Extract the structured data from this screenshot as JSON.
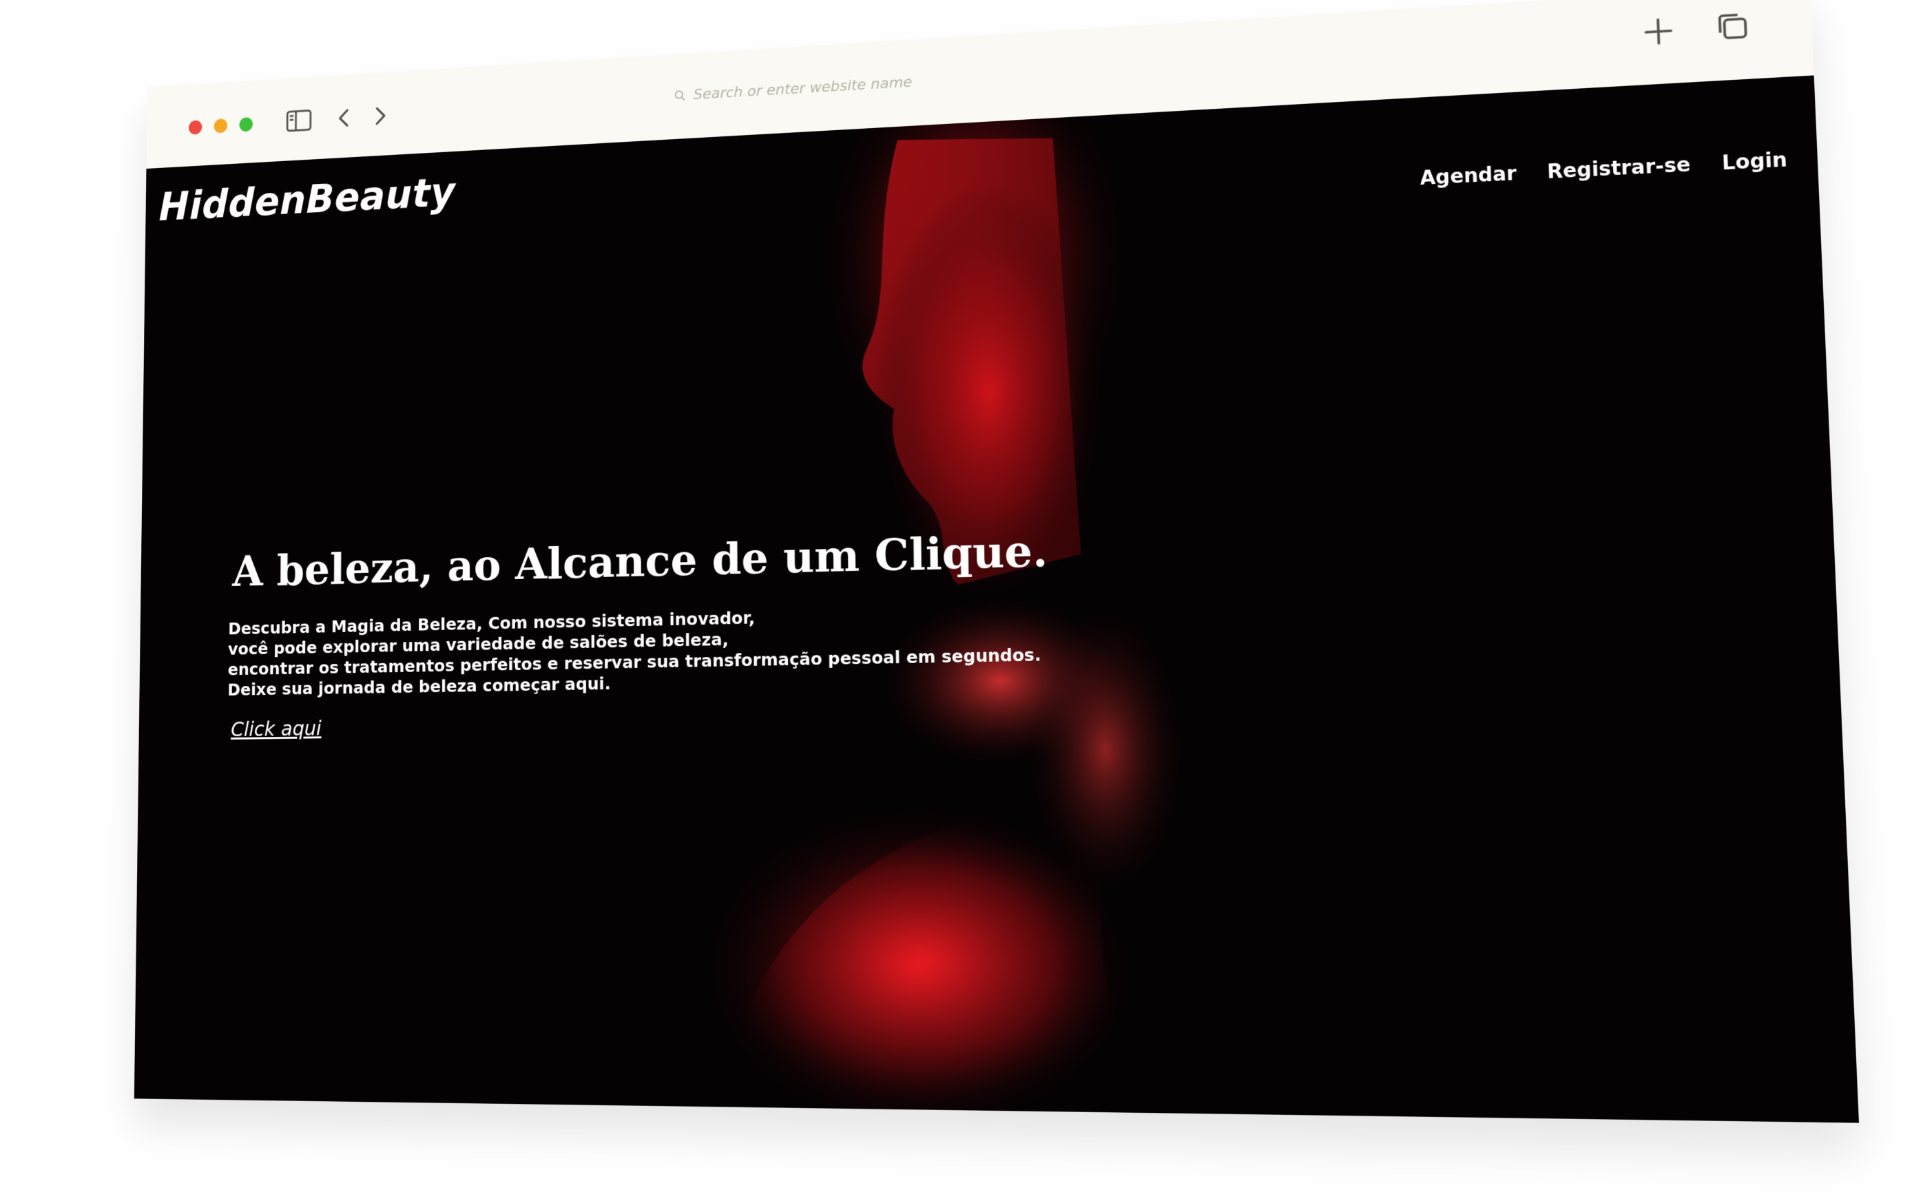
{
  "browser": {
    "address_placeholder": "Search or enter website name"
  },
  "site": {
    "brand": "HiddenBeauty",
    "nav": [
      {
        "label": "Agendar"
      },
      {
        "label": "Registrar-se"
      },
      {
        "label": "Login"
      }
    ]
  },
  "hero": {
    "headline": "A beleza, ao Alcance de um Clique.",
    "description_lines": [
      "Descubra a Magia da Beleza, Com nosso sistema inovador,",
      "você pode explorar uma variedade de salões de beleza,",
      "encontrar os tratamentos perfeitos e reservar sua transformação pessoal em segundos.",
      "Deixe sua jornada de beleza começar aqui."
    ],
    "cta": "Click aqui"
  },
  "colors": {
    "background": "#050203",
    "accent_red": "#d9141b",
    "chrome": "#fbf9f3"
  },
  "icons": {
    "traffic": [
      "close-dot",
      "minimize-dot",
      "zoom-dot"
    ],
    "toolbar": [
      "sidebar-icon",
      "back-icon",
      "forward-icon",
      "search-icon",
      "new-tab-icon",
      "tab-overview-icon"
    ]
  }
}
